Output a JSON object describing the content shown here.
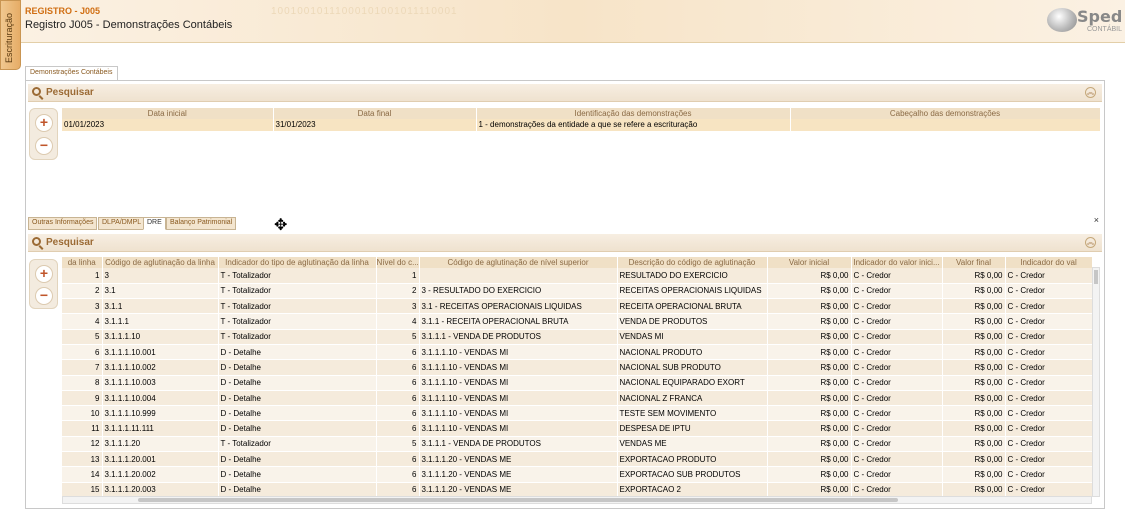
{
  "side_tab": {
    "label": "Escrituração"
  },
  "header": {
    "reg_code": "REGISTRO - J005",
    "reg_title": "Registro J005 - Demonstrações Contábeis",
    "bits": "10010010111000101001011110001",
    "logo_main": "Sped",
    "logo_sub": "CONTÁBIL"
  },
  "outer_tab": {
    "label": "Demonstrações Contábeis"
  },
  "top_panel": {
    "title": "Pesquisar",
    "collapse_icon": "chevron-double-up-icon",
    "columns": [
      "Data inicial",
      "Data final",
      "Identificação das demonstrações",
      "Cabeçalho das demonstrações"
    ],
    "rows": [
      [
        "01/01/2023",
        "31/01/2023",
        "1 - demonstrações da entidade a que se refere a escrituração",
        ""
      ]
    ]
  },
  "sub_tabs": [
    "Outras Informações",
    "DLPA/DMPL",
    "DRE",
    "Balanço Patrimonial"
  ],
  "active_sub_tab": "DRE",
  "close_label": "×",
  "bottom_panel": {
    "title": "Pesquisar",
    "columns": [
      "da linha",
      "Código de aglutinação da linha",
      "Indicador do tipo de aglutinação da linha",
      "Nível do c...",
      "Código de aglutinação de nível superior",
      "Descrição do código de aglutinação",
      "Valor inicial",
      "Indicador do valor inici...",
      "Valor final",
      "Indicador do val"
    ],
    "rows": [
      [
        "1",
        "3",
        "T - Totalizador",
        "1",
        "",
        "RESULTADO DO EXERCICIO",
        "R$ 0,00",
        "C - Credor",
        "R$ 0,00",
        "C - Credor"
      ],
      [
        "2",
        "3.1",
        "T - Totalizador",
        "2",
        "3 - RESULTADO DO EXERCICIO",
        "RECEITAS OPERACIONAIS LIQUIDAS",
        "R$ 0,00",
        "C - Credor",
        "R$ 0,00",
        "C - Credor"
      ],
      [
        "3",
        "3.1.1",
        "T - Totalizador",
        "3",
        "3.1 - RECEITAS OPERACIONAIS LIQUIDAS",
        "RECEITA OPERACIONAL BRUTA",
        "R$ 0,00",
        "C - Credor",
        "R$ 0,00",
        "C - Credor"
      ],
      [
        "4",
        "3.1.1.1",
        "T - Totalizador",
        "4",
        "3.1.1 - RECEITA OPERACIONAL BRUTA",
        "VENDA DE PRODUTOS",
        "R$ 0,00",
        "C - Credor",
        "R$ 0,00",
        "C - Credor"
      ],
      [
        "5",
        "3.1.1.1.10",
        "T - Totalizador",
        "5",
        "3.1.1.1 - VENDA DE PRODUTOS",
        "VENDAS MI",
        "R$ 0,00",
        "C - Credor",
        "R$ 0,00",
        "C - Credor"
      ],
      [
        "6",
        "3.1.1.1.10.001",
        "D - Detalhe",
        "6",
        "3.1.1.1.10 - VENDAS MI",
        "NACIONAL PRODUTO",
        "R$ 0,00",
        "C - Credor",
        "R$ 0,00",
        "C - Credor"
      ],
      [
        "7",
        "3.1.1.1.10.002",
        "D - Detalhe",
        "6",
        "3.1.1.1.10 - VENDAS MI",
        "NACIONAL SUB PRODUTO",
        "R$ 0,00",
        "C - Credor",
        "R$ 0,00",
        "C - Credor"
      ],
      [
        "8",
        "3.1.1.1.10.003",
        "D - Detalhe",
        "6",
        "3.1.1.1.10 - VENDAS MI",
        "NACIONAL EQUIPARADO EXORT",
        "R$ 0,00",
        "C - Credor",
        "R$ 0,00",
        "C - Credor"
      ],
      [
        "9",
        "3.1.1.1.10.004",
        "D - Detalhe",
        "6",
        "3.1.1.1.10 - VENDAS MI",
        "NACIONAL Z FRANCA",
        "R$ 0,00",
        "C - Credor",
        "R$ 0,00",
        "C - Credor"
      ],
      [
        "10",
        "3.1.1.1.10.999",
        "D - Detalhe",
        "6",
        "3.1.1.1.10 - VENDAS MI",
        "TESTE SEM MOVIMENTO",
        "R$ 0,00",
        "C - Credor",
        "R$ 0,00",
        "C - Credor"
      ],
      [
        "11",
        "3.1.1.1.11.111",
        "D - Detalhe",
        "6",
        "3.1.1.1.10 - VENDAS MI",
        "DESPESA DE IPTU",
        "R$ 0,00",
        "C - Credor",
        "R$ 0,00",
        "C - Credor"
      ],
      [
        "12",
        "3.1.1.1.20",
        "T - Totalizador",
        "5",
        "3.1.1.1 - VENDA DE PRODUTOS",
        "VENDAS ME",
        "R$ 0,00",
        "C - Credor",
        "R$ 0,00",
        "C - Credor"
      ],
      [
        "13",
        "3.1.1.1.20.001",
        "D - Detalhe",
        "6",
        "3.1.1.1.20 - VENDAS ME",
        "EXPORTACAO PRODUTO",
        "R$ 0,00",
        "C - Credor",
        "R$ 0,00",
        "C - Credor"
      ],
      [
        "14",
        "3.1.1.1.20.002",
        "D - Detalhe",
        "6",
        "3.1.1.1.20 - VENDAS ME",
        "EXPORTACAO SUB PRODUTOS",
        "R$ 0,00",
        "C - Credor",
        "R$ 0,00",
        "C - Credor"
      ],
      [
        "15",
        "3.1.1.1.20.003",
        "D - Detalhe",
        "6",
        "3.1.1.1.20 - VENDAS ME",
        "EXPORTACAO 2",
        "R$ 0,00",
        "C - Credor",
        "R$ 0,00",
        "C - Credor"
      ]
    ]
  },
  "buttons": {
    "add": "+",
    "remove": "−"
  },
  "colors": {
    "accent": "#d06e12",
    "header_bg": "#f0e0c6",
    "row_sel": "#f7e4c2"
  }
}
